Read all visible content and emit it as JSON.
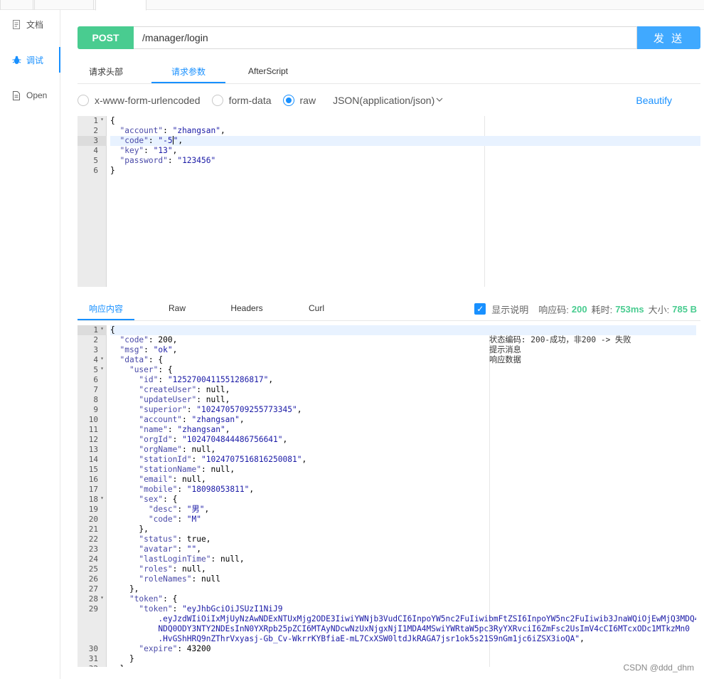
{
  "sidebar": {
    "items": [
      {
        "label": "文档",
        "icon": "document-icon"
      },
      {
        "label": "调试",
        "icon": "bug-icon"
      },
      {
        "label": "Open",
        "icon": "file-icon"
      }
    ]
  },
  "request": {
    "method": "POST",
    "url": "/manager/login",
    "send_label": "发 送"
  },
  "request_tabs": [
    "请求头部",
    "请求参数",
    "AfterScript"
  ],
  "body_types": {
    "options": [
      "x-www-form-urlencoded",
      "form-data",
      "raw"
    ],
    "content_type": "JSON(application/json)",
    "beautify": "Beautify"
  },
  "request_body": {
    "lines": [
      "1",
      "2",
      "3",
      "4",
      "5",
      "6"
    ]
  },
  "response_tabs": [
    "响应内容",
    "Raw",
    "Headers",
    "Curl"
  ],
  "response_meta": {
    "show_desc": "显示说明",
    "status_label": "响应码:",
    "status": "200",
    "time_label": "耗时:",
    "time": "753ms",
    "size_label": "大小:",
    "size": "785 B"
  },
  "response_desc": [
    "状态编码: 200-成功，非200 -> 失败",
    "提示消息",
    "响应数据"
  ],
  "watermark": "CSDN @ddd_dhm",
  "colors": {
    "accent": "#1890ff",
    "post": "#49cc90",
    "send": "#40a9ff"
  }
}
